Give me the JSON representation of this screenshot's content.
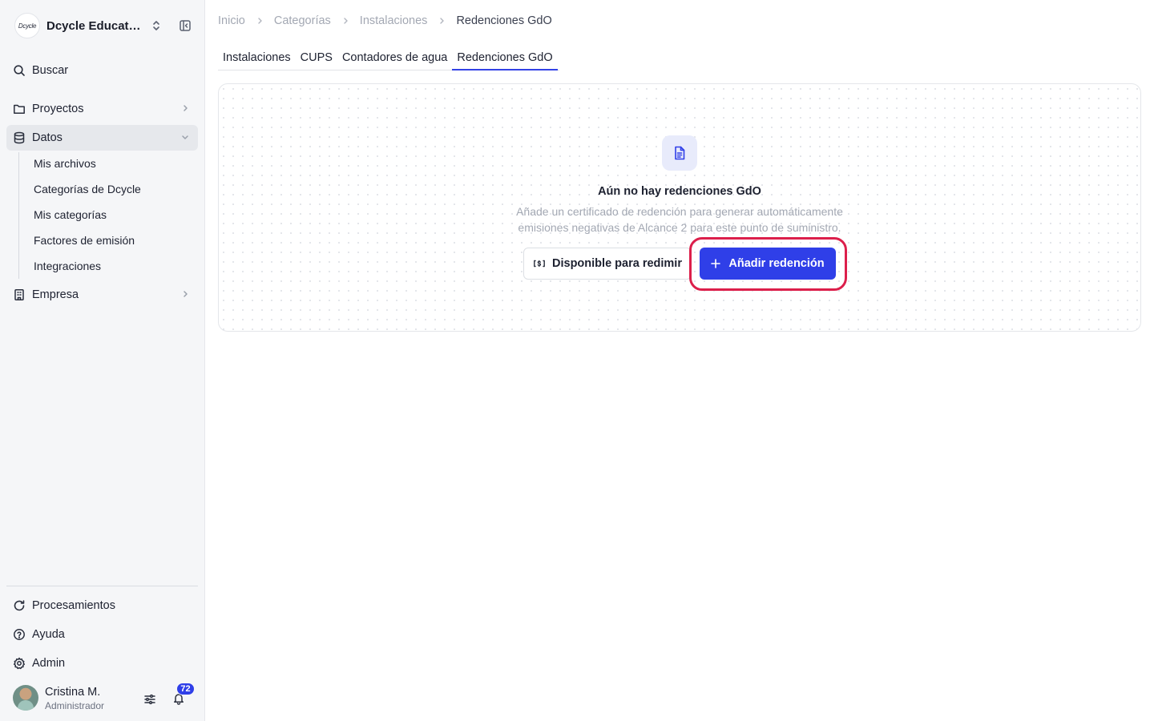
{
  "brand": {
    "logo_text": "Dcycle",
    "name": "Dcycle Education"
  },
  "sidebar": {
    "search_label": "Buscar",
    "projects_label": "Proyectos",
    "data_label": "Datos",
    "data_items": [
      {
        "label": "Mis archivos"
      },
      {
        "label": "Categorías de Dcycle"
      },
      {
        "label": "Mis categorías"
      },
      {
        "label": "Factores de emisión"
      },
      {
        "label": "Integraciones"
      }
    ],
    "company_label": "Empresa",
    "processing_label": "Procesamientos",
    "help_label": "Ayuda",
    "admin_label": "Admin"
  },
  "user": {
    "name": "Cristina M.",
    "role": "Administrador",
    "notifications": "72"
  },
  "breadcrumb": [
    "Inicio",
    "Categorías",
    "Instalaciones",
    "Redenciones GdO"
  ],
  "tabs": [
    "Instalaciones",
    "CUPS",
    "Contadores de agua",
    "Redenciones GdO"
  ],
  "active_tab": "Redenciones GdO",
  "empty_state": {
    "title": "Aún no hay redenciones GdO",
    "description": "Añade un certificado de redención para generar automáticamente emisiones negativas de Alcance 2 para este punto de suministro.",
    "secondary_button": "Disponible para redimir",
    "primary_button": "Añadir redención"
  },
  "colors": {
    "primary": "#2f3fe8",
    "highlight": "#dc1f4b",
    "sidebar_bg": "#f5f6f8"
  }
}
